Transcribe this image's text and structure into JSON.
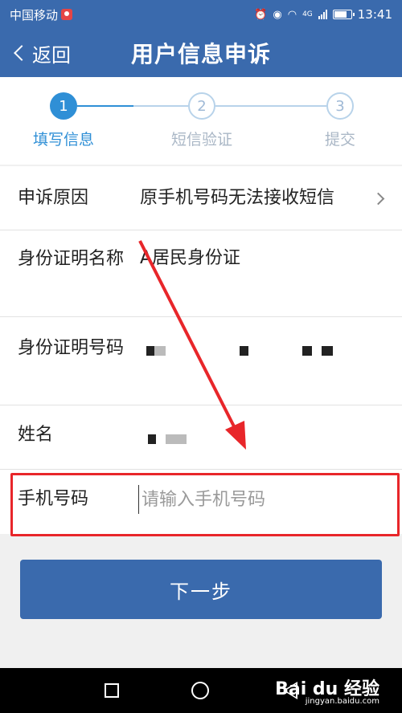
{
  "status_bar": {
    "carrier": "中国移动",
    "time": "13:41",
    "network": "4G"
  },
  "nav": {
    "back_label": "返回",
    "title": "用户信息申诉"
  },
  "steps": [
    {
      "number": "1",
      "label": "填写信息",
      "active": true
    },
    {
      "number": "2",
      "label": "短信验证",
      "active": false
    },
    {
      "number": "3",
      "label": "提交",
      "active": false
    }
  ],
  "form": {
    "reason": {
      "label": "申诉原因",
      "value": "原手机号码无法接收短信"
    },
    "id_type": {
      "label": "身份证明名称",
      "value": "A居民身份证"
    },
    "id_number": {
      "label": "身份证明号码",
      "value": ""
    },
    "name": {
      "label": "姓名",
      "value": ""
    },
    "phone": {
      "label": "手机号码",
      "value": "",
      "placeholder": "请输入手机号码"
    }
  },
  "next_button": {
    "label": "下一步"
  },
  "watermark": {
    "brand": "Bai du 经验",
    "sub": "jingyan.baidu.com"
  },
  "colors": {
    "primary": "#3a6aad",
    "step_active": "#2f8fd6",
    "step_inactive": "#b8d3ea",
    "highlight": "#e8262a"
  }
}
